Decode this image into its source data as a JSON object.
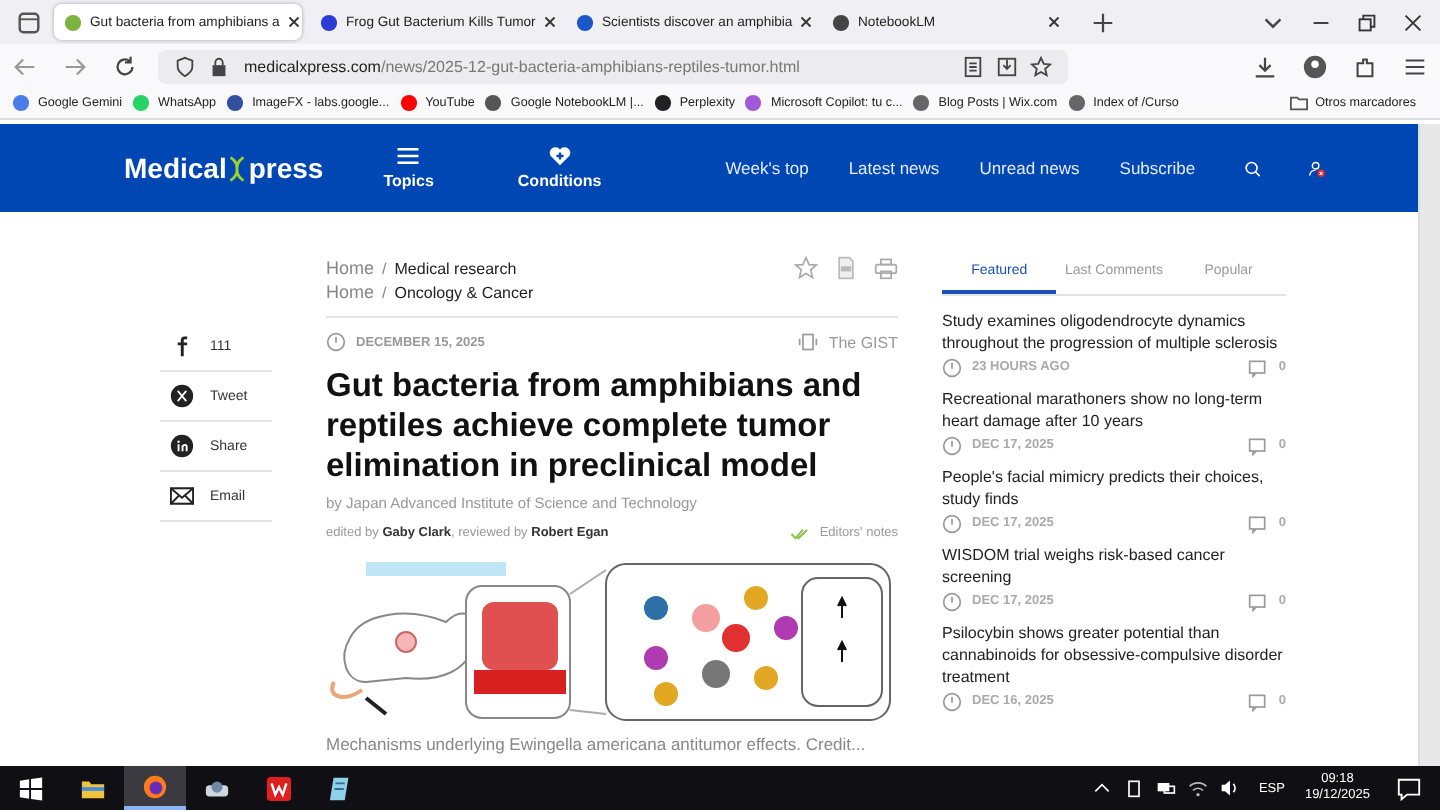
{
  "browser": {
    "tabs": [
      {
        "title": "Gut bacteria from amphibians a",
        "selected": true,
        "color": "#7cb342"
      },
      {
        "title": "Frog Gut Bacterium Kills Tumor",
        "selected": false,
        "color": "#2a3bd6"
      },
      {
        "title": "Scientists discover an amphibia",
        "selected": false,
        "color": "#1a56c8"
      },
      {
        "title": "NotebookLM",
        "selected": false,
        "color": "#444444"
      }
    ],
    "url": {
      "host": "medicalxpress.com",
      "path": "/news/2025-12-gut-bacteria-amphibians-reptiles-tumor.html"
    },
    "bookmarks": [
      {
        "label": "Google Gemini",
        "color": "#4a7de8"
      },
      {
        "label": "WhatsApp",
        "color": "#25d366"
      },
      {
        "label": "ImageFX - labs.google...",
        "color": "#3050a0"
      },
      {
        "label": "YouTube",
        "color": "#ff0000"
      },
      {
        "label": "Google NotebookLM |...",
        "color": "#555555"
      },
      {
        "label": "Perplexity",
        "color": "#222222"
      },
      {
        "label": "Microsoft Copilot: tu c...",
        "color": "#a05ad8"
      },
      {
        "label": "Blog Posts | Wix.com",
        "color": "#666666"
      },
      {
        "label": "Index of /Curso",
        "color": "#666666"
      }
    ],
    "other_bookmarks": "Otros marcadores"
  },
  "site": {
    "logo_left": "Medical",
    "logo_right": "press",
    "menu": [
      {
        "label": "Topics",
        "kind": "menu"
      },
      {
        "label": "Conditions",
        "kind": "heart"
      }
    ],
    "nav": [
      "Week's top",
      "Latest news",
      "Unread news",
      "Subscribe"
    ]
  },
  "share": [
    {
      "label": "111",
      "kind": "facebook"
    },
    {
      "label": "Tweet",
      "kind": "x"
    },
    {
      "label": "Share",
      "kind": "linkedin"
    },
    {
      "label": "Email",
      "kind": "email"
    }
  ],
  "article": {
    "breadcrumbs": [
      {
        "home": "Home",
        "sep": "/",
        "section": "Medical research"
      },
      {
        "home": "Home",
        "sep": "/",
        "section": "Oncology & Cancer"
      }
    ],
    "date": "DECEMBER 15, 2025",
    "gist": "The GIST",
    "title": "Gut bacteria from amphibians and reptiles achieve complete tumor elimination in preclinical model",
    "byline": "by Japan Advanced Institute of Science and Technology",
    "edited": "edited by **Gaby Clark**, reviewed by **Robert Egan**",
    "editors_notes": "Editors' notes",
    "caption": "Mechanisms underlying Ewingella americana antitumor effects. Credit..."
  },
  "sidebar": {
    "tabs": [
      {
        "label": "Featured",
        "selected": true
      },
      {
        "label": "Last Comments",
        "selected": false
      },
      {
        "label": "Popular",
        "selected": false
      }
    ],
    "items": [
      {
        "headline": "Study examines oligodendrocyte dynamics throughout the progression of multiple sclerosis",
        "date": "23 HOURS AGO",
        "comments": "0"
      },
      {
        "headline": "Recreational marathoners show no long-term heart damage after 10 years",
        "date": "DEC 17, 2025",
        "comments": "0"
      },
      {
        "headline": "People's facial mimicry predicts their choices, study finds",
        "date": "DEC 17, 2025",
        "comments": "0"
      },
      {
        "headline": "WISDOM trial weighs risk-based cancer screening",
        "date": "DEC 17, 2025",
        "comments": "0"
      },
      {
        "headline": "Psilocybin shows greater potential than cannabinoids for obsessive-compulsive disorder treatment",
        "date": "DEC 16, 2025",
        "comments": "0"
      }
    ]
  },
  "taskbar": {
    "apps": [
      {
        "kind": "folder",
        "selected": false
      },
      {
        "kind": "firefox",
        "selected": true
      },
      {
        "kind": "scanner",
        "selected": false
      },
      {
        "kind": "wps",
        "selected": false
      },
      {
        "kind": "notepad",
        "selected": false
      }
    ],
    "language": "ESP",
    "time": "09:18",
    "date": "19/12/2025"
  }
}
